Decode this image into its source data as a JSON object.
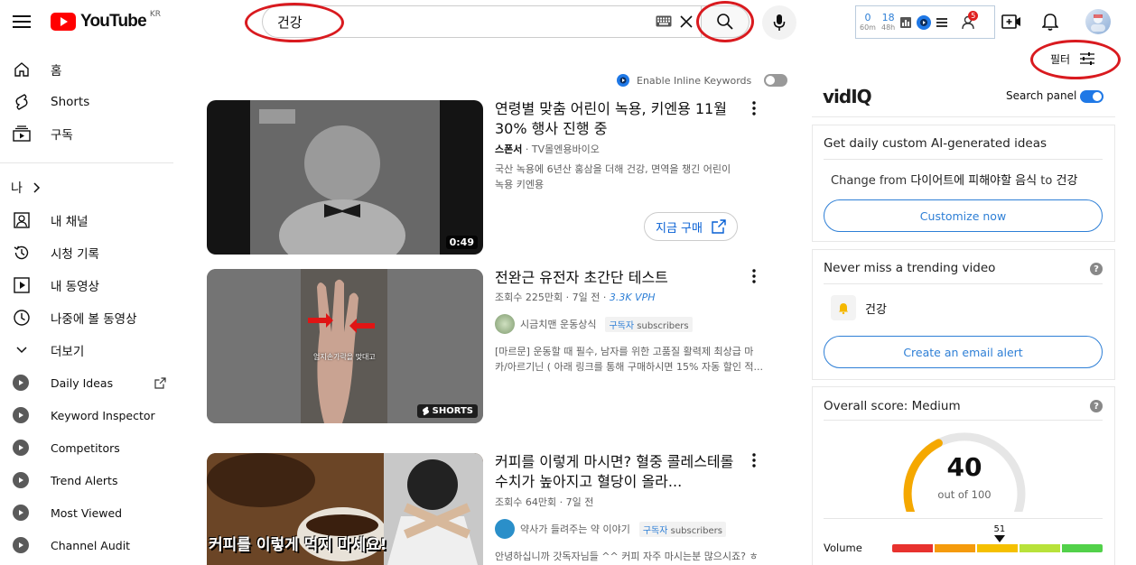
{
  "header": {
    "logo_text": "YouTube",
    "country_code": "KR",
    "search_value": "건강",
    "vidiq_stats": [
      {
        "value": "0",
        "label": "60m"
      },
      {
        "value": "18",
        "label": "48h"
      }
    ],
    "notification_badge": "5"
  },
  "filter": {
    "label": "필터"
  },
  "sidebar": {
    "main": [
      {
        "label": "홈",
        "icon": "home-icon"
      },
      {
        "label": "Shorts",
        "icon": "shorts-icon"
      },
      {
        "label": "구독",
        "icon": "subscriptions-icon"
      }
    ],
    "you_heading": "나",
    "you_items": [
      {
        "label": "내 채널",
        "icon": "my-channel-icon"
      },
      {
        "label": "시청 기록",
        "icon": "history-icon"
      },
      {
        "label": "내 동영상",
        "icon": "my-videos-icon"
      },
      {
        "label": "나중에 볼 동영상",
        "icon": "watch-later-icon"
      },
      {
        "label": "더보기",
        "icon": "chevron-down-icon"
      }
    ],
    "vidiq_items": [
      {
        "label": "Daily Ideas"
      },
      {
        "label": "Keyword Inspector"
      },
      {
        "label": "Competitors"
      },
      {
        "label": "Trend Alerts"
      },
      {
        "label": "Most Viewed"
      },
      {
        "label": "Channel Audit"
      }
    ]
  },
  "inline_keywords": {
    "label": "Enable Inline Keywords"
  },
  "videos": [
    {
      "title": "연령별 맞춤 어린이 녹용, 키엔용 11월 30% 행사 진행 중",
      "sponsor": "스폰서",
      "channel": "TV몰엔용바이오",
      "description_lines": [
        "국산 녹용에 6년산 홍삼을 더해 건강, 면역을 챙긴 어린이",
        "녹용 키엔용"
      ],
      "duration": "0:49",
      "cta": "지금 구매"
    },
    {
      "title": "전완근 유전자 초간단 테스트",
      "views": "조회수 225만회",
      "age": "7일 전",
      "vph": "3.3K VPH",
      "channel": "시금치맨 운동상식",
      "subs_label": "구독자",
      "subs_suffix": "subscribers",
      "description_lines": [
        "[마르문] 운동할 때 필수, 남자를 위한 고품질 활력제 최상급 마",
        "카/아르기닌 ( 아래 링크를 통해 구매하시면 15% 자동 할인 적..."
      ],
      "badge": "SHORTS",
      "thumb_caption": "엄지손가락을 맞대고"
    },
    {
      "title": "커피를 이렇게 마시면? 혈중 콜레스테롤 수치가 높아지고 혈당이 올라...",
      "views": "조회수 64만회",
      "age": "7일 전",
      "channel": "약사가 들려주는 약 이야기",
      "subs_label": "구독자",
      "subs_suffix": "subscribers",
      "description_lines": [
        "안녕하십니까 갓독자님들 ^^ 커피 자주 마시는분 많으시죠? ㅎㅎ"
      ],
      "thumb_caption": "커피를 이렇게 먹지 마세요!"
    }
  ],
  "vidiq_panel": {
    "brand": "vidIQ",
    "search_panel_label": "Search panel",
    "ideas": {
      "title": "Get daily custom AI-generated ideas",
      "change_prefix": "Change from",
      "change_from": "다이어트에 피해야할 음식",
      "change_mid": "to",
      "change_to": "건강",
      "button": "Customize now"
    },
    "trending": {
      "title": "Never miss a trending video",
      "keyword": "건강",
      "button": "Create an email alert"
    },
    "score": {
      "title": "Overall score: Medium",
      "value": 40,
      "max_label": "out of 100",
      "volume_label": "Volume",
      "volume_value": 51
    }
  },
  "colors": {
    "youtube_red": "#ff0000",
    "vidiq_blue": "#2e7fd6",
    "annotation_red": "#d91a1f",
    "gauge_orange": "#f5a800",
    "gauge_track": "#e6e6e6"
  }
}
